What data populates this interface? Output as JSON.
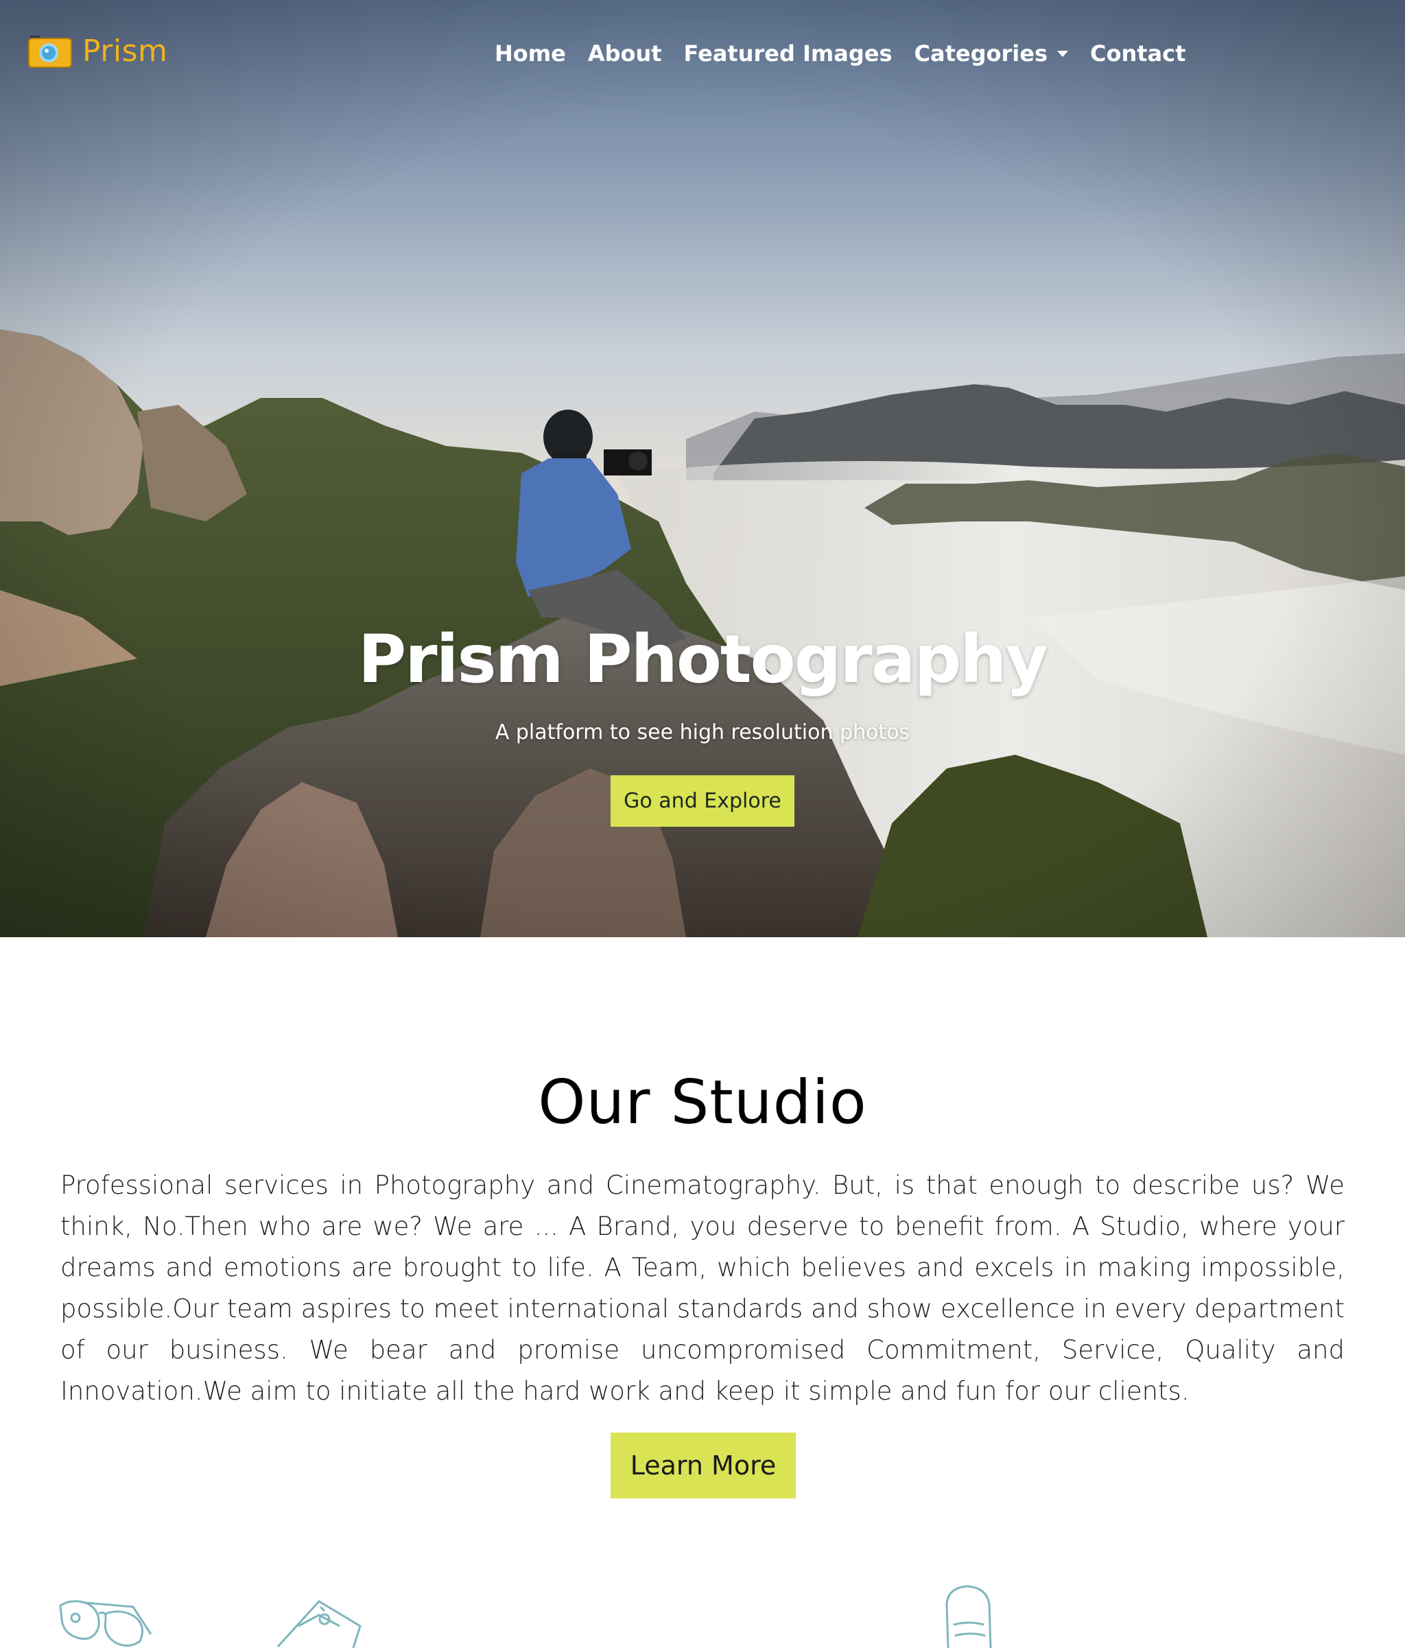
{
  "brand": {
    "name": "Prism",
    "accent_color": "#f2b21b",
    "logo_icon": "camera-icon"
  },
  "nav": {
    "items": [
      {
        "label": "Home"
      },
      {
        "label": "About"
      },
      {
        "label": "Featured Images"
      },
      {
        "label": "Categories",
        "has_dropdown": true
      },
      {
        "label": "Contact"
      }
    ]
  },
  "hero": {
    "title": "Prism Photography",
    "subtitle": "A platform to see high resolution photos",
    "cta_label": "Go and Explore",
    "cta_color": "#d9e354",
    "background": "photographer-on-mountain-photo"
  },
  "studio": {
    "title": "Our Studio",
    "description": "Professional services in Photography and Cinematography. But, is that enough to describe us? We think, No.Then who are we? We are ... A Brand, you deserve to benefit from. A Studio, where your dreams and emotions are brought to life. A Team, which believes and excels in making impossible, possible.Our team aspires to meet international standards and show excellence in every department of our business. We bear and promise uncompromised Commitment, Service, Quality and Innovation.We aim to initiate all the hard work and keep it simple and fun for our clients.",
    "cta_label": "Learn More",
    "cta_color": "#d9e354"
  },
  "decor": {
    "icons": [
      "glasses-icon",
      "camera-sketch-icon",
      "bag-icon"
    ]
  }
}
